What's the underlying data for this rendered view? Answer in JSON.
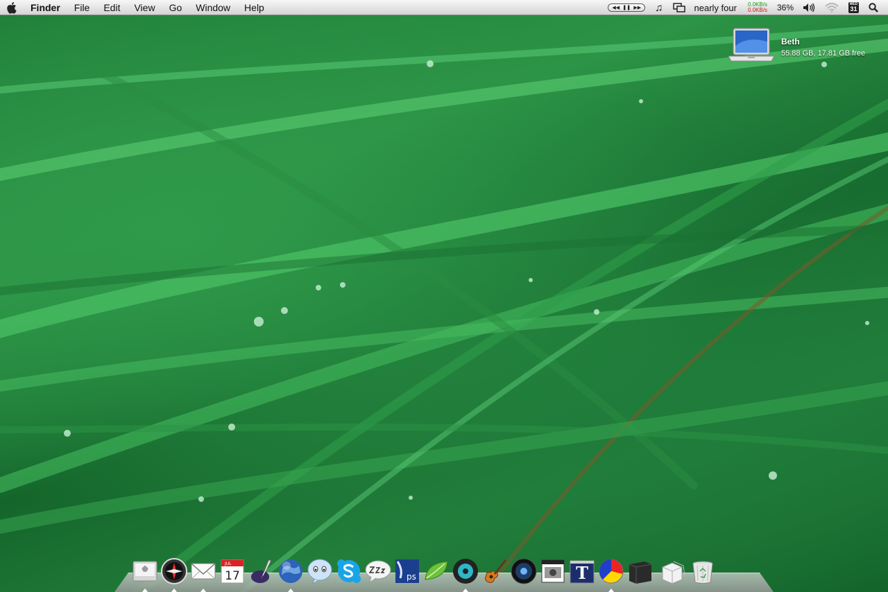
{
  "menubar": {
    "app_name": "Finder",
    "menus": [
      "File",
      "Edit",
      "View",
      "Go",
      "Window"
    ],
    "help": "Help",
    "now_playing": "nearly four",
    "net_down": "0.0KB/s",
    "net_up": "0.0KB/s",
    "battery": "36%",
    "calendar_day": "WED",
    "calendar_date": "31",
    "icons": [
      "apple-logo",
      "itunes-controls",
      "music-note-icon",
      "spaces-icon",
      "volume-icon",
      "wifi-icon",
      "calendar-icon",
      "spotlight-icon"
    ]
  },
  "desktop": {
    "drive_name": "Beth",
    "drive_info": "55.88 GB, 17.81 GB free"
  },
  "dock": {
    "calendar_month": "JUL",
    "calendar_date": "17",
    "items": [
      {
        "name": "finder-icon",
        "running": true
      },
      {
        "name": "safari-icon",
        "running": true
      },
      {
        "name": "mail-icon",
        "running": true
      },
      {
        "name": "ical-icon",
        "running": false
      },
      {
        "name": "quill-app-icon",
        "running": false
      },
      {
        "name": "network-globe-icon",
        "running": true
      },
      {
        "name": "adium-icon",
        "running": false
      },
      {
        "name": "skype-icon",
        "running": false
      },
      {
        "name": "sleep-chat-icon",
        "running": false
      },
      {
        "name": "photoshop-icon",
        "running": false
      },
      {
        "name": "leaf-icon",
        "running": false
      },
      {
        "name": "itunes-icon",
        "running": true
      },
      {
        "name": "garageband-icon",
        "running": false
      },
      {
        "name": "speaker-icon",
        "running": false
      },
      {
        "name": "photo-booth-icon",
        "running": false
      },
      {
        "name": "text-edit-icon",
        "running": false
      },
      {
        "name": "color-picker-icon",
        "running": true
      },
      {
        "name": "black-box-icon",
        "running": false
      },
      {
        "name": "packages-icon",
        "running": false
      },
      {
        "name": "trash-icon",
        "running": false
      }
    ]
  },
  "colors": {
    "wallpaper_green": "#1e7a36",
    "menubar_bg": "#e2e2e2",
    "net_down": "#1a9a1a",
    "net_up": "#c21a1a"
  }
}
